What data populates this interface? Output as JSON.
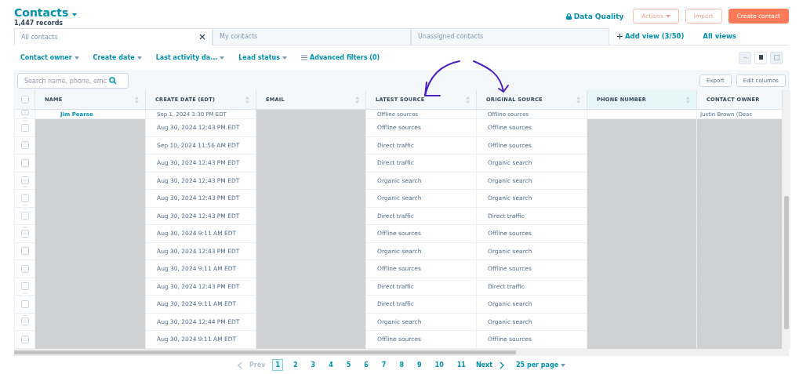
{
  "header": {
    "title": "Contacts",
    "record_count": "1,447 records",
    "data_quality": "Data Quality",
    "buttons": [
      {
        "label": "Actions",
        "kind": "dropdown"
      },
      {
        "label": "Import",
        "kind": "outline"
      },
      {
        "label": "Create contact",
        "kind": "primary"
      }
    ]
  },
  "views": [
    {
      "label": "All contacts",
      "selected": true
    },
    {
      "label": "My contacts",
      "selected": false
    },
    {
      "label": "Unassigned contacts",
      "selected": false
    }
  ],
  "add_view": "Add view (3/50)",
  "all_views": "All views",
  "filters": [
    "Contact owner",
    "Create date",
    "Last activity da...",
    "Lead status"
  ],
  "advanced_filters": "Advanced filters (0)",
  "search": {
    "placeholder": "Search name, phone, emc"
  },
  "table_buttons": [
    "Export",
    "Edit columns"
  ],
  "select_all": {
    "checked": false
  },
  "columns": [
    {
      "label": "NAME",
      "selected": false
    },
    {
      "label": "CREATE DATE (EDT)",
      "selected": false
    },
    {
      "label": "EMAIL",
      "selected": false
    },
    {
      "label": "LATEST SOURCE",
      "selected": false
    },
    {
      "label": "ORIGINAL SOURCE",
      "selected": false
    },
    {
      "label": "PHONE NUMBER",
      "selected": true
    },
    {
      "label": "CONTACT OWNER",
      "selected": false
    }
  ],
  "partial_row": {
    "name": "Jim Pearse",
    "create_date": "Sep 1, 2024 3:30 PM EDT",
    "latest_source": "Offline sources",
    "original_source": "Offline sources",
    "contact_owner": "Justin Brown (Deac",
    "checked": false
  },
  "rows": [
    {
      "create_date": "Aug 30, 2024 12:43 PM EDT",
      "latest_source": "Offline sources",
      "original_source": "Offline sources",
      "checked": false
    },
    {
      "create_date": "Sep 10, 2024 11:56 AM EDT",
      "latest_source": "Direct traffic",
      "original_source": "Offline sources",
      "checked": false
    },
    {
      "create_date": "Aug 30, 2024 12:43 PM EDT",
      "latest_source": "Direct traffic",
      "original_source": "Organic search",
      "checked": false
    },
    {
      "create_date": "Aug 30, 2024 12:43 PM EDT",
      "latest_source": "Organic search",
      "original_source": "Organic search",
      "checked": false
    },
    {
      "create_date": "Aug 30, 2024 12:43 PM EDT",
      "latest_source": "Organic search",
      "original_source": "Organic search",
      "checked": false
    },
    {
      "create_date": "Aug 30, 2024 12:43 PM EDT",
      "latest_source": "Direct traffic",
      "original_source": "Direct traffic",
      "checked": false
    },
    {
      "create_date": "Aug 30, 2024 9:11 AM EDT",
      "latest_source": "Offline sources",
      "original_source": "Offline sources",
      "checked": false
    },
    {
      "create_date": "Aug 30, 2024 12:43 PM EDT",
      "latest_source": "Organic search",
      "original_source": "Organic search",
      "checked": false
    },
    {
      "create_date": "Aug 30, 2024 9:11 AM EDT",
      "latest_source": "Offline sources",
      "original_source": "Offline sources",
      "checked": false
    },
    {
      "create_date": "Aug 30, 2024 12:43 PM EDT",
      "latest_source": "Direct traffic",
      "original_source": "Direct traffic",
      "checked": false
    },
    {
      "create_date": "Aug 30, 2024 9:11 AM EDT",
      "latest_source": "Direct traffic",
      "original_source": "Organic search",
      "checked": false
    },
    {
      "create_date": "Aug 30, 2024 12:44 PM EDT",
      "latest_source": "Organic search",
      "original_source": "Organic search",
      "checked": false
    },
    {
      "create_date": "Aug 30, 2024 9:11 AM EDT",
      "latest_source": "Offline sources",
      "original_source": "Offline sources",
      "checked": false
    }
  ],
  "pagination": {
    "prev": "Prev",
    "pages": [
      {
        "label": "1",
        "selected": true
      },
      {
        "label": "2",
        "selected": false
      },
      {
        "label": "3",
        "selected": false
      },
      {
        "label": "4",
        "selected": false
      },
      {
        "label": "5",
        "selected": false
      },
      {
        "label": "6",
        "selected": false
      },
      {
        "label": "7",
        "selected": false
      },
      {
        "label": "8",
        "selected": false
      },
      {
        "label": "9",
        "selected": false
      },
      {
        "label": "10",
        "selected": false
      },
      {
        "label": "11",
        "selected": false
      }
    ],
    "next": "Next",
    "per_page": "25 per page"
  }
}
